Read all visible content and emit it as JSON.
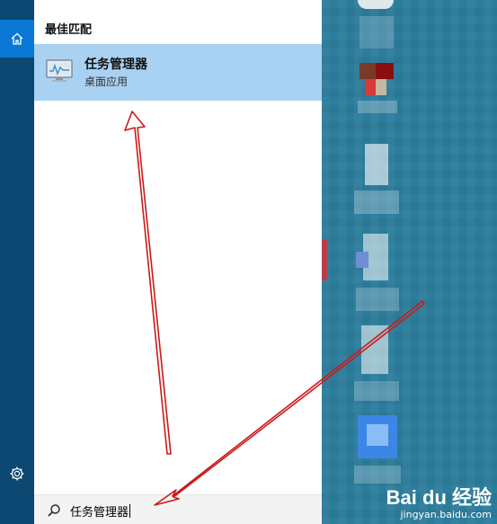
{
  "panel": {
    "section_label": "最佳匹配",
    "best_match": {
      "name": "任务管理器",
      "type": "桌面应用",
      "icon": "task-manager-icon"
    }
  },
  "search": {
    "value": "任务管理器",
    "icon": "search-icon"
  },
  "rail": {
    "home_icon": "home-icon",
    "settings_icon": "gear-icon"
  },
  "watermark": {
    "brand": "Bai du 经验",
    "url": "jingyan.baidu.com"
  },
  "colors": {
    "rail": "#0b4770",
    "rail_active": "#0a78d4",
    "highlight": "#a9d1f2",
    "annotation": "#cc1a1a"
  }
}
